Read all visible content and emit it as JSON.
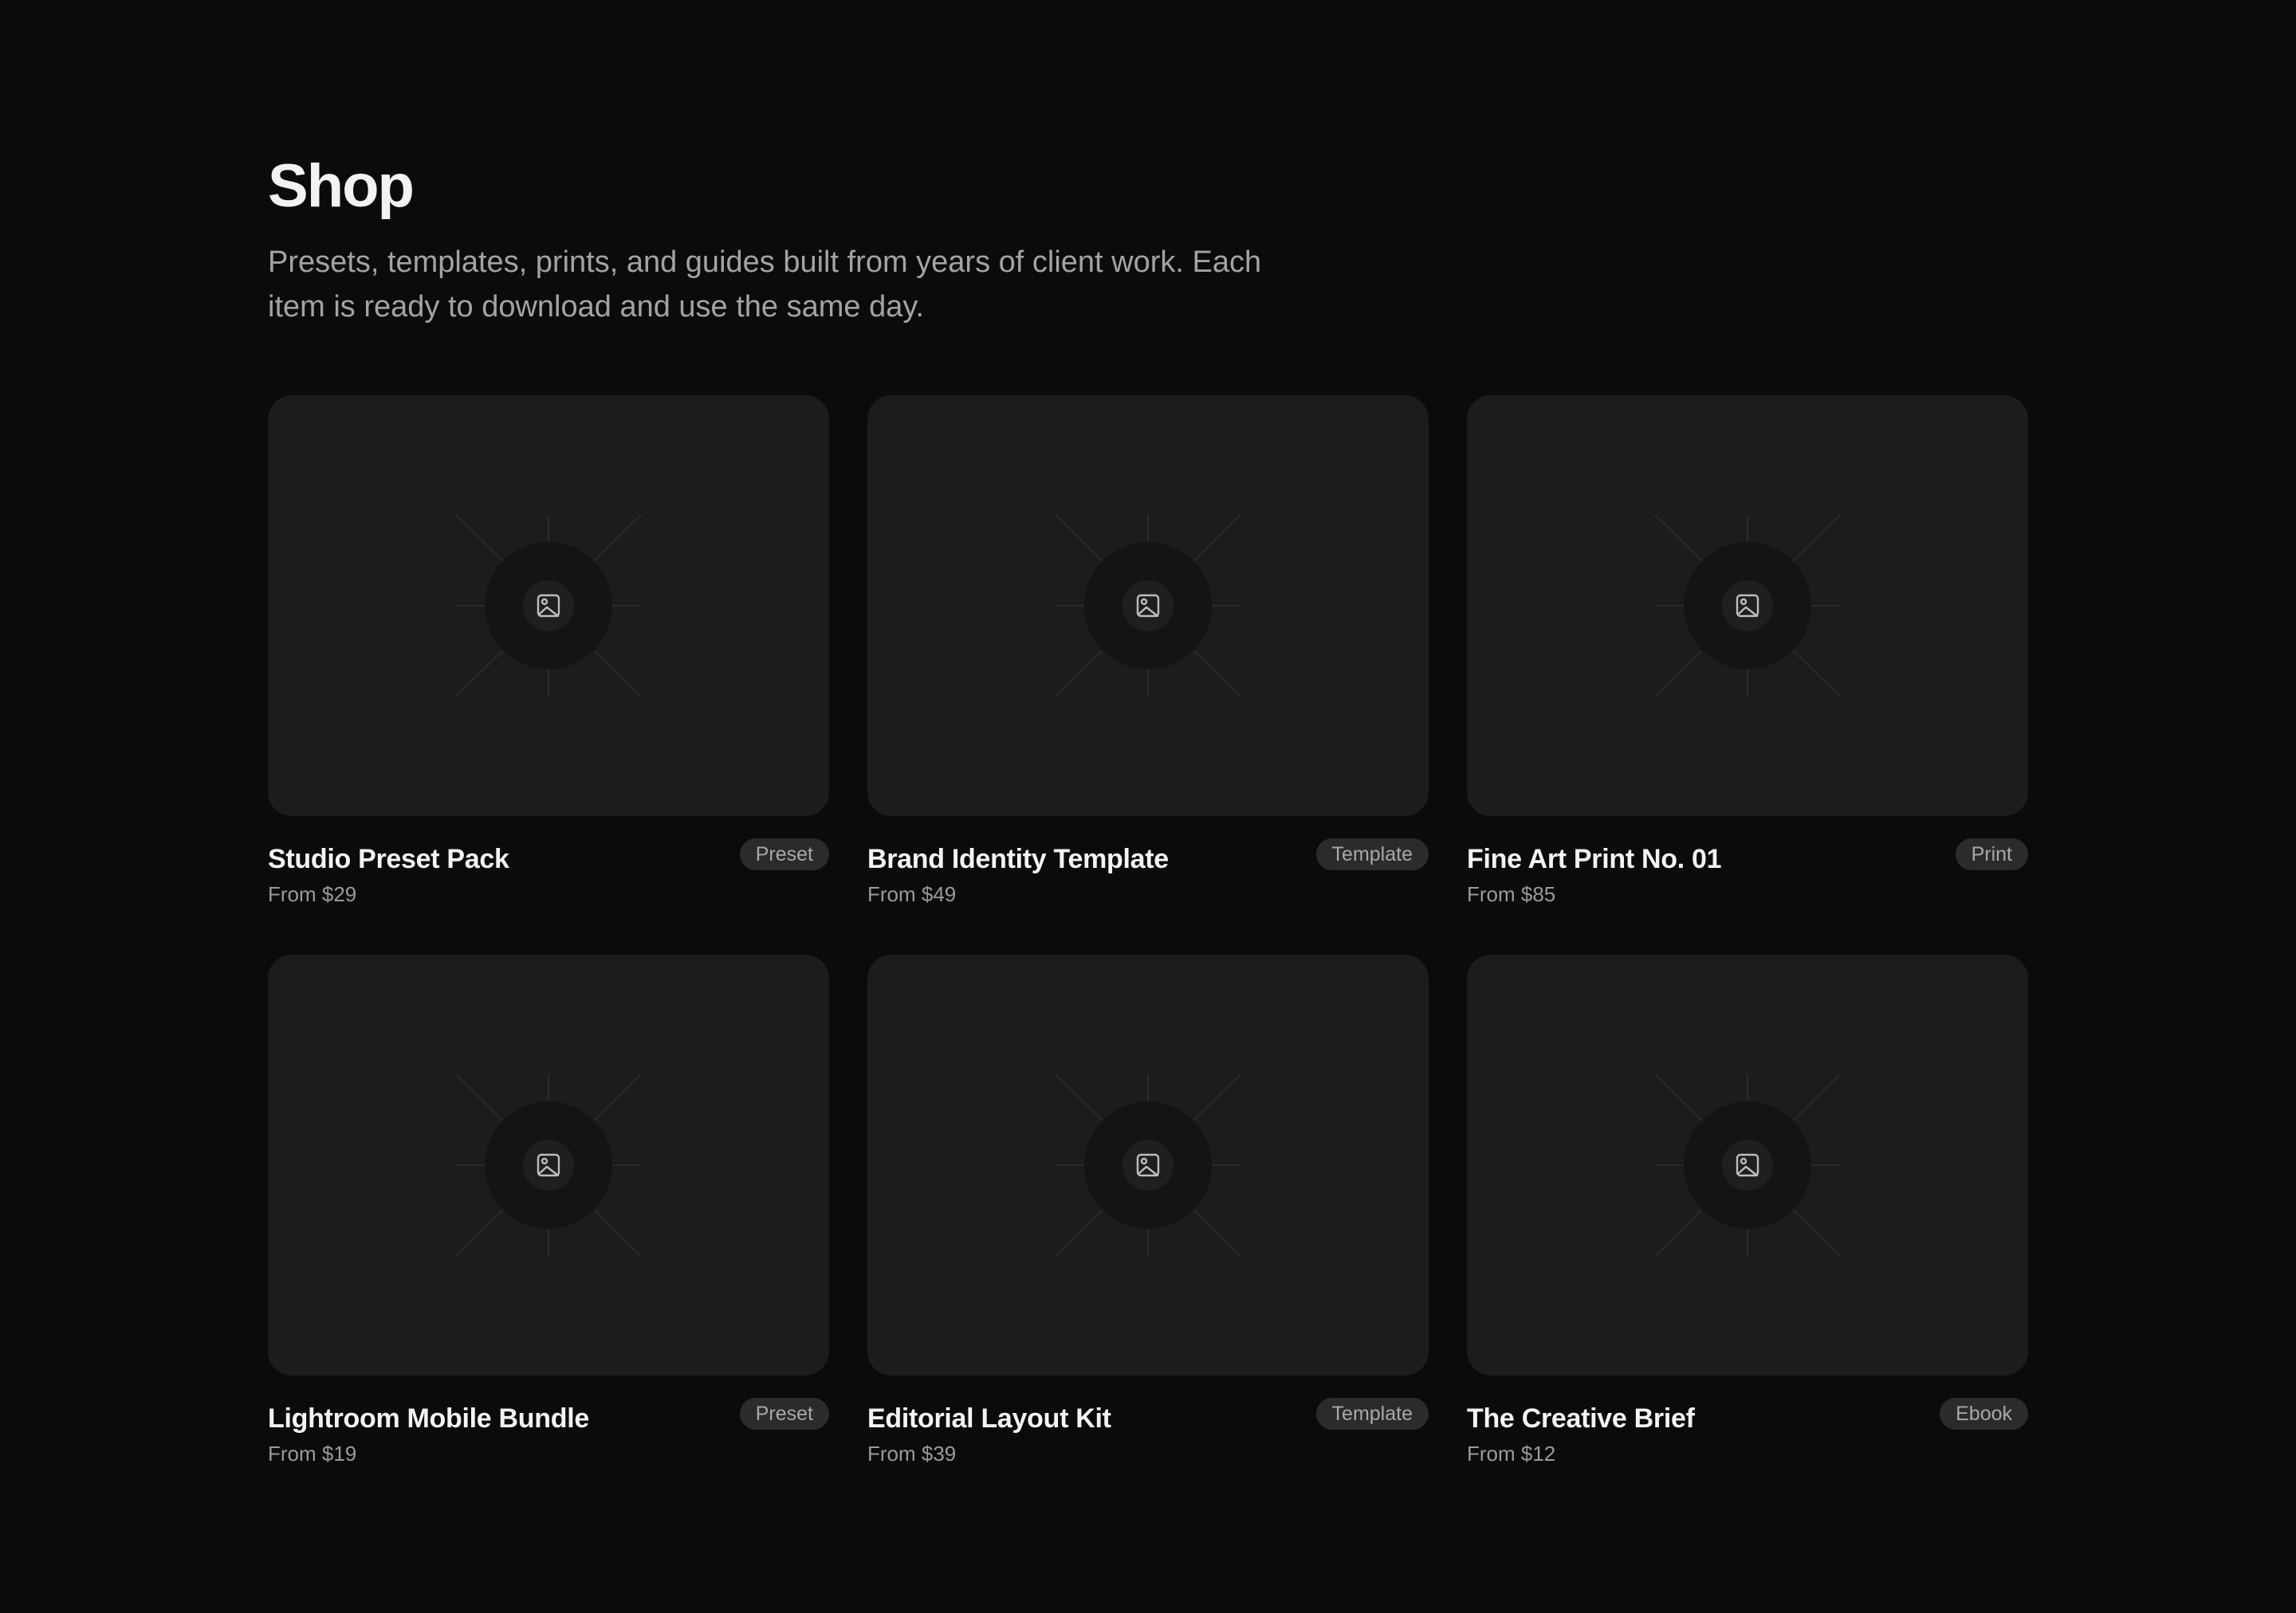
{
  "header": {
    "title": "Shop",
    "intro": "Presets, templates, prints, and guides built from years of client work. Each item is ready to download and use the same day."
  },
  "icons": {
    "placeholder": "image-icon"
  },
  "colors": {
    "background": "#0b0b0b",
    "card": "#1c1c1c",
    "badge": "#2b2b2b",
    "text_primary": "#f4f4f4",
    "text_secondary": "#9a9a9a"
  },
  "products": [
    {
      "name": "Studio Preset Pack",
      "price": "From $29",
      "tag": "Preset"
    },
    {
      "name": "Brand Identity Template",
      "price": "From $49",
      "tag": "Template"
    },
    {
      "name": "Fine Art Print No. 01",
      "price": "From $85",
      "tag": "Print"
    },
    {
      "name": "Lightroom Mobile Bundle",
      "price": "From $19",
      "tag": "Preset"
    },
    {
      "name": "Editorial Layout Kit",
      "price": "From $39",
      "tag": "Template"
    },
    {
      "name": "The Creative Brief",
      "price": "From $12",
      "tag": "Ebook"
    }
  ]
}
